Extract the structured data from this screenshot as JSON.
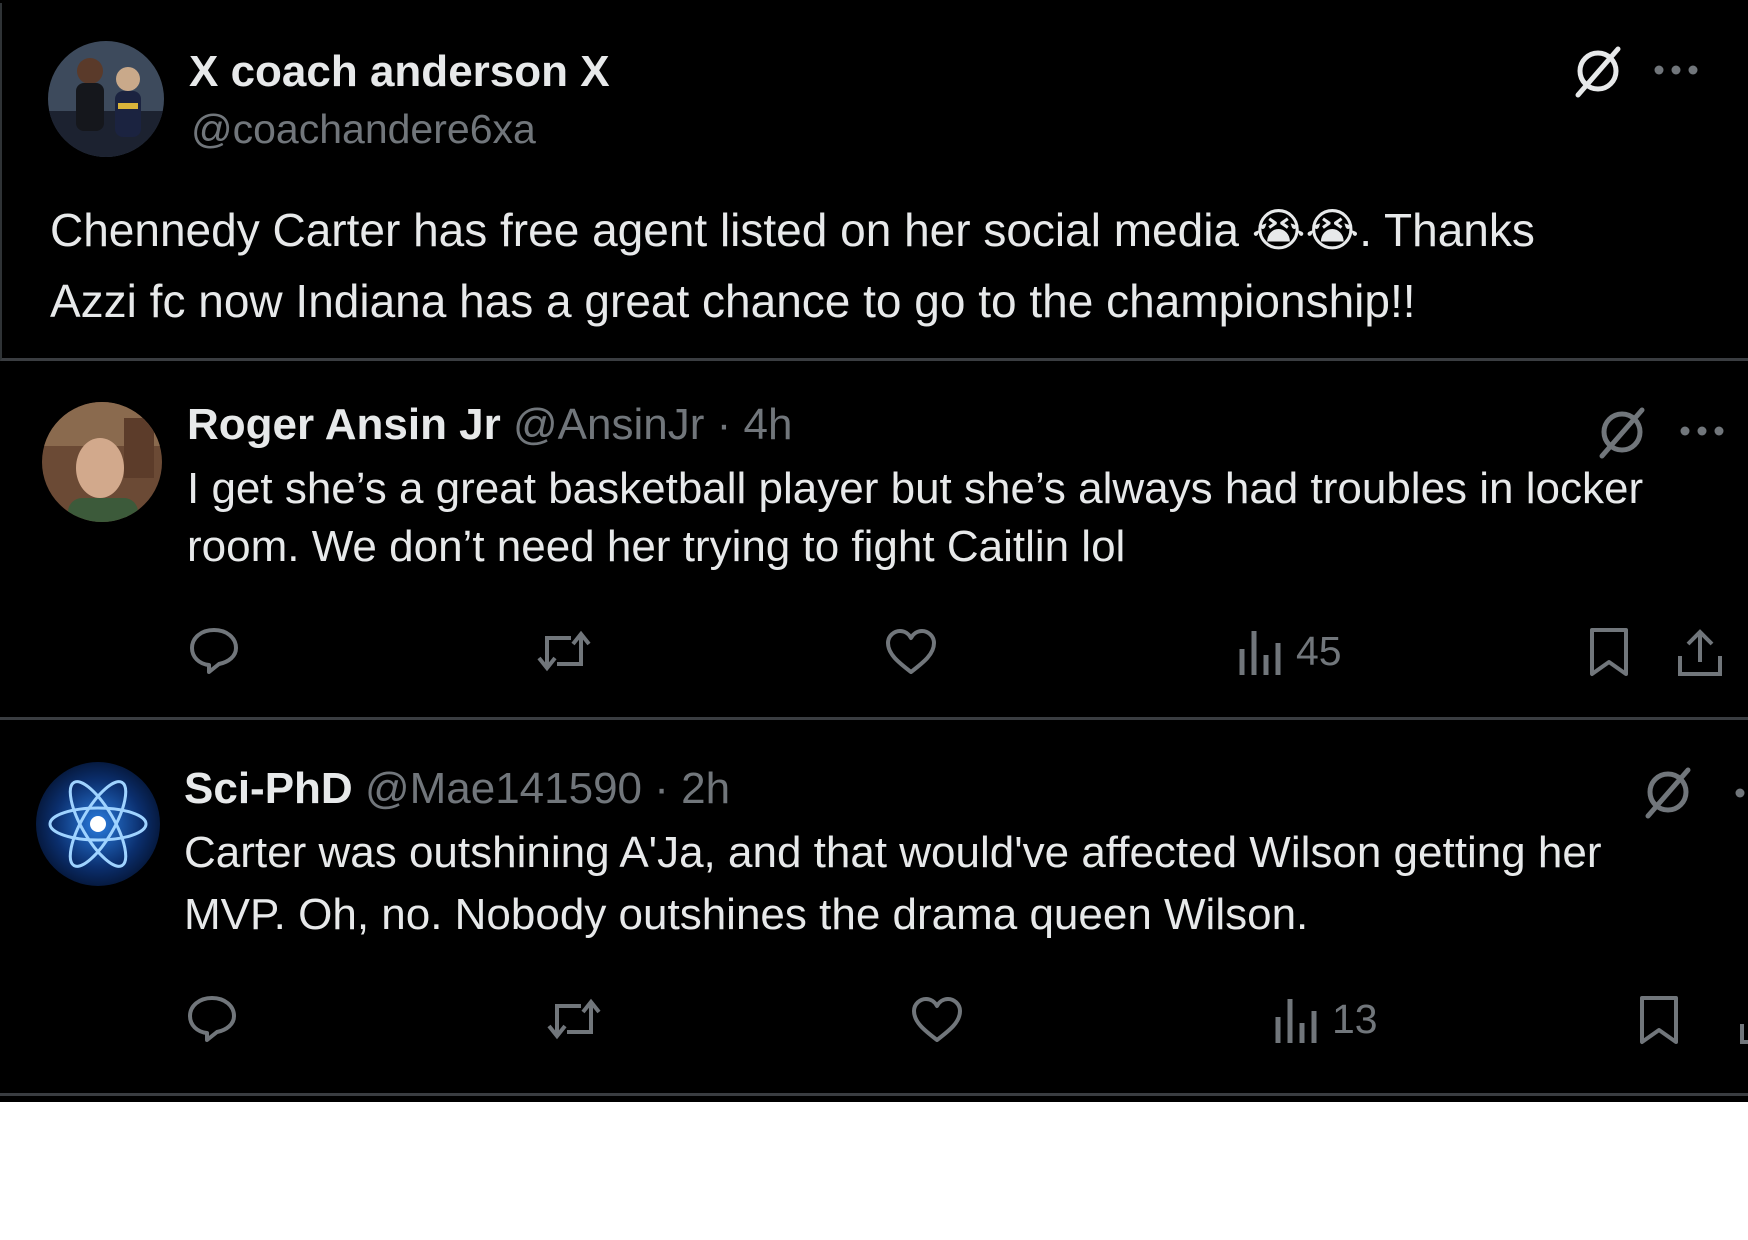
{
  "main_post": {
    "display_name": "X coach anderson X",
    "handle": "@coachandere6xa",
    "text_line1_before": "Chennedy Carter has free agent listed on her social media ",
    "emoji": "😭😭",
    "text_line1_after": ". Thanks",
    "text_line2": "Azzi fc now Indiana has a great chance to go to the championship!!",
    "icons": [
      "grok-icon",
      "more-icon"
    ]
  },
  "replies": [
    {
      "display_name": "Roger Ansin Jr",
      "handle": "@AnsinJr",
      "separator": "·",
      "time": "4h",
      "text_line1": "I get she’s a great basketball player but she’s always had troubles in locker",
      "text_line2": "room. We don’t need her trying to fight Caitlin lol",
      "views": "45",
      "icons": [
        "reply-icon",
        "repost-icon",
        "like-icon",
        "views-icon",
        "bookmark-icon",
        "share-icon"
      ]
    },
    {
      "display_name": "Sci-PhD",
      "handle": "@Mae141590",
      "separator": "·",
      "time": "2h",
      "text_line1": "Carter was outshining A'Ja, and that would've affected Wilson getting her",
      "text_line2": "MVP. Oh, no. Nobody outshines the drama queen Wilson.",
      "views": "13",
      "icons": [
        "reply-icon",
        "repost-icon",
        "like-icon",
        "views-icon",
        "bookmark-icon",
        "share-icon"
      ]
    }
  ],
  "colors": {
    "background": "#000000",
    "text_primary": "#e7e9ea",
    "text_secondary": "#71767b",
    "divider": "#3a3d41",
    "page_background": "#ffffff"
  }
}
